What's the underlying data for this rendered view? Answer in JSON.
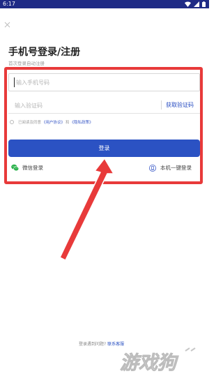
{
  "status_bar": {
    "time": "6:17",
    "icons": [
      "wifi-icon",
      "signal-icon",
      "battery-icon"
    ],
    "background": "#1f2b86"
  },
  "header": {
    "close_icon": "close-icon",
    "title": "手机号登录/注册",
    "subtitle": "首次登录自动注册"
  },
  "form": {
    "phone_placeholder": "输入手机号码",
    "code_placeholder": "输入验证码",
    "get_code_label": "获取验证码",
    "agreement": {
      "prefix": "已阅读及同意",
      "user_agreement": "《用户协议》",
      "and": "和",
      "privacy_policy": "《隐私政策》"
    },
    "login_label": "登录"
  },
  "alt_login": {
    "wechat_label": "微信登录",
    "onekey_label": "本机一键登录"
  },
  "footer": {
    "help_text": "登录遇到问题?",
    "contact_label": "联系客服"
  },
  "watermark": {
    "text": "游戏狗"
  },
  "colors": {
    "accent": "#2b52c3",
    "annotation": "#e83a3a",
    "wechat": "#2bb24c"
  }
}
